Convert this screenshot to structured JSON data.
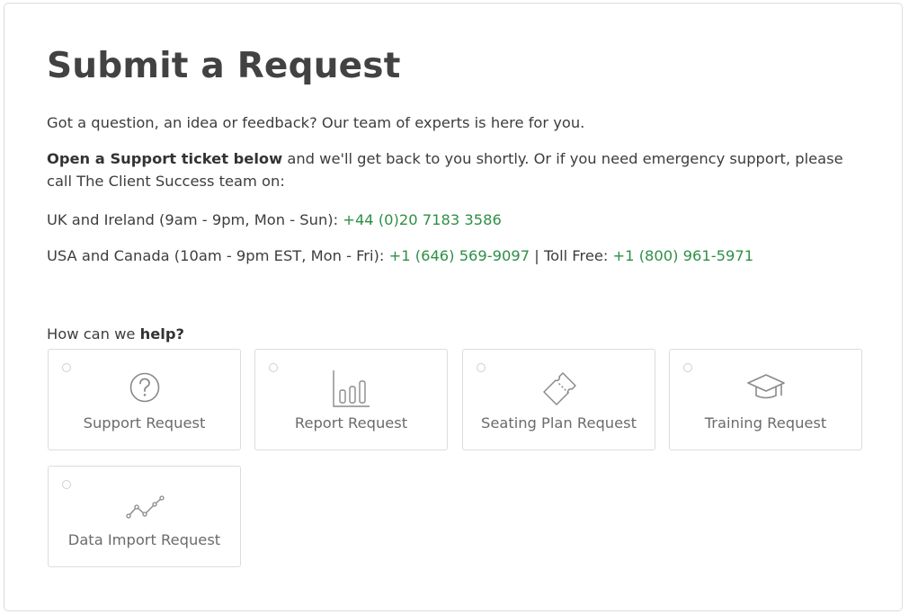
{
  "page": {
    "title": "Submit a Request",
    "intro": "Got a question, an idea or feedback? Our team of experts is here for you.",
    "support_bold": "Open a Support ticket below",
    "support_rest_line": "and we'll get back to you shortly. Or if you need emergency support, please call The Client Success team on:",
    "uk_label": "UK and Ireland (9am - 9pm, Mon - Sun):",
    "uk_phone": "+44 (0)20 7183 3586",
    "usa_label": "USA and Canada (10am - 9pm EST, Mon - Fri):",
    "usa_phone": "+1 (646) 569-9097",
    "toll_free_label": "| Toll Free:",
    "toll_free_phone": "+1 (800) 961-5971",
    "help_prefix": "How can we",
    "help_bold": "help?"
  },
  "request_types": [
    {
      "label": "Support Request",
      "icon": "question-circle-icon"
    },
    {
      "label": "Report Request",
      "icon": "bar-chart-icon"
    },
    {
      "label": "Seating Plan Request",
      "icon": "ticket-icon"
    },
    {
      "label": "Training Request",
      "icon": "graduation-cap-icon"
    },
    {
      "label": "Data Import Request",
      "icon": "line-chart-icon"
    }
  ],
  "colors": {
    "link_green": "#2f8f46",
    "heading": "#424242",
    "tile_border": "#dcdcdc",
    "icon_gray": "#8a8a8a"
  }
}
